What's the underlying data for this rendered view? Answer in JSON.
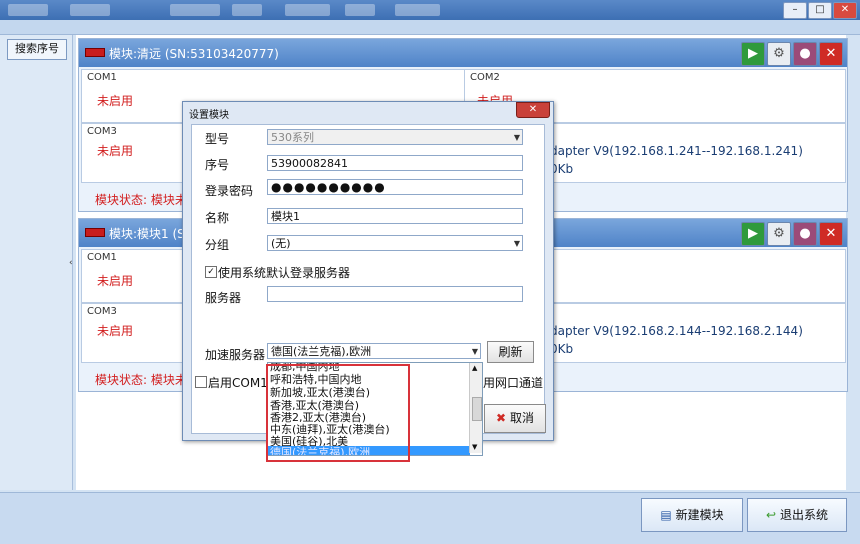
{
  "window": {
    "minimize": "–",
    "maximize": "□",
    "close": "✕"
  },
  "left": {
    "search_button": "搜索序号",
    "splitter_arrow": "‹"
  },
  "modules": [
    {
      "title": "模块:清远 (SN:53103420777)",
      "com1_label": "COM1",
      "com1_status": "未启用",
      "com2_label": "COM2",
      "com2_status": "未启用",
      "com3_label": "COM3",
      "com3_status": "未启用",
      "adapter": "dapter V9(192.168.1.241--192.168.1.241)",
      "speed": "0Kb",
      "status": "模块状态: 模块未"
    },
    {
      "title": "模块:模块1 (S",
      "com1_label": "COM1",
      "com1_status": "未启用",
      "com3_label": "COM3",
      "com3_status": "未启用",
      "adapter": "dapter V9(192.168.2.144--192.168.2.144)",
      "speed": "0Kb",
      "status": "模块状态: 模块未"
    }
  ],
  "dialog": {
    "title": "设置模块",
    "close": "✕",
    "model_label": "型号",
    "model_value": "530系列",
    "serial_label": "序号",
    "serial_value": "53900082841",
    "password_label": "登录密码",
    "password_value": "●●●●●●●●●●",
    "name_label": "名称",
    "name_value": "模块1",
    "group_label": "分组",
    "group_value": "(无)",
    "use_default_server_label": "使用系统默认登录服务器",
    "server_label": "服务器",
    "server_value": "",
    "accel_label": "加速服务器",
    "accel_value": "德国(法兰克福),欧洲",
    "refresh_label": "刷新",
    "enable_com1_label": "启用COM1通",
    "enable_net_label": "用网口通道",
    "cancel_label": "取消",
    "options": [
      "成都,中国内地",
      "呼和浩特,中国内地",
      "新加坡,亚太(港澳台)",
      "香港,亚太(港澳台)",
      "香港2,亚太(港澳台)",
      "中东(迪拜),亚太(港澳台)",
      "美国(硅谷),北美",
      "德国(法兰克福),欧洲"
    ]
  },
  "bottom": {
    "new_module": "新建模块",
    "exit": "退出系统"
  }
}
